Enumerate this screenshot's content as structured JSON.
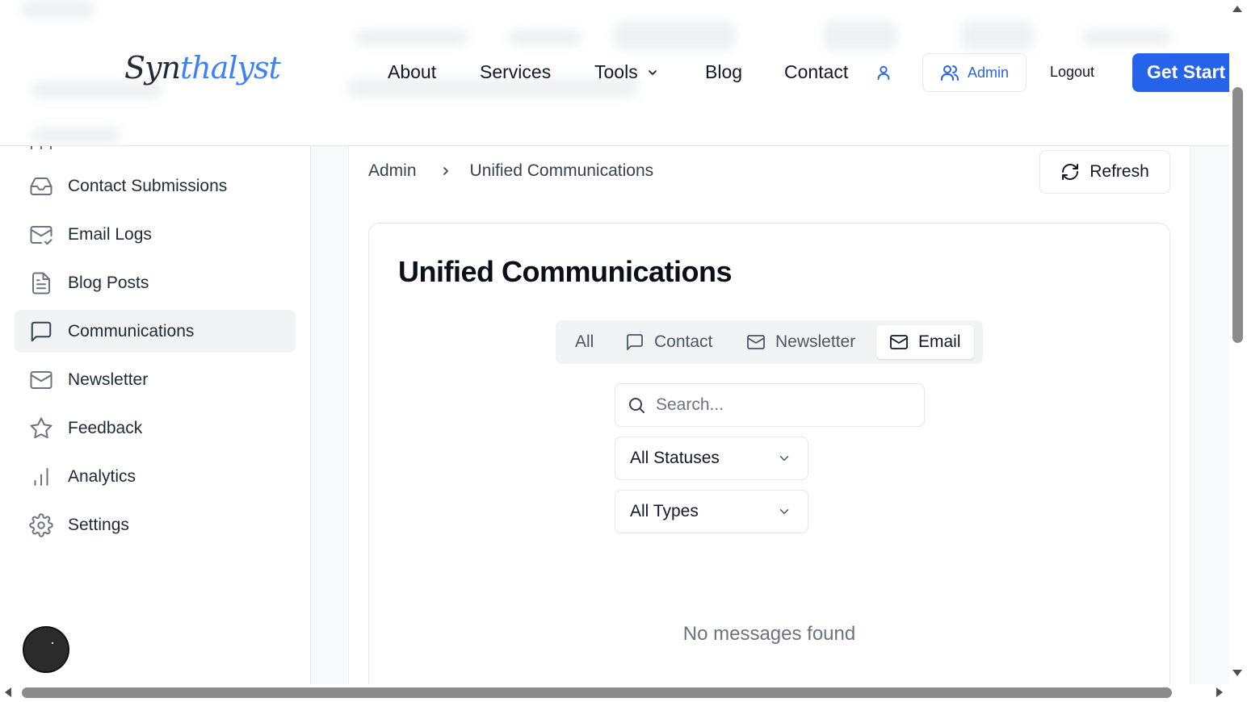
{
  "header": {
    "logo_part1": "Syn",
    "logo_part2": "thalyst",
    "nav": {
      "about": "About",
      "services": "Services",
      "tools": "Tools",
      "blog": "Blog",
      "contact": "Contact"
    },
    "admin_label": "Admin",
    "logout_label": "Logout",
    "cta_label": "Get Start"
  },
  "sidebar": {
    "items": [
      {
        "label": "Contact Submissions",
        "icon": "inbox-icon"
      },
      {
        "label": "Email Logs",
        "icon": "mail-check-icon"
      },
      {
        "label": "Blog Posts",
        "icon": "file-text-icon"
      },
      {
        "label": "Communications",
        "icon": "message-square-icon",
        "active": true
      },
      {
        "label": "Newsletter",
        "icon": "mail-icon"
      },
      {
        "label": "Feedback",
        "icon": "star-icon"
      },
      {
        "label": "Analytics",
        "icon": "bar-chart-icon"
      },
      {
        "label": "Settings",
        "icon": "gear-icon"
      }
    ]
  },
  "breadcrumb": {
    "root": "Admin",
    "current": "Unified Communications"
  },
  "refresh_label": "Refresh",
  "main": {
    "title": "Unified Communications",
    "tabs": [
      {
        "label": "All"
      },
      {
        "label": "Contact"
      },
      {
        "label": "Newsletter"
      },
      {
        "label": "Email",
        "active": true
      }
    ],
    "search_placeholder": "Search...",
    "status_select": "All Statuses",
    "type_select": "All Types",
    "empty_message": "No messages found"
  },
  "colors": {
    "accent": "#2563eb",
    "active_bg": "#f1f3f5",
    "border": "#e5e7eb"
  }
}
